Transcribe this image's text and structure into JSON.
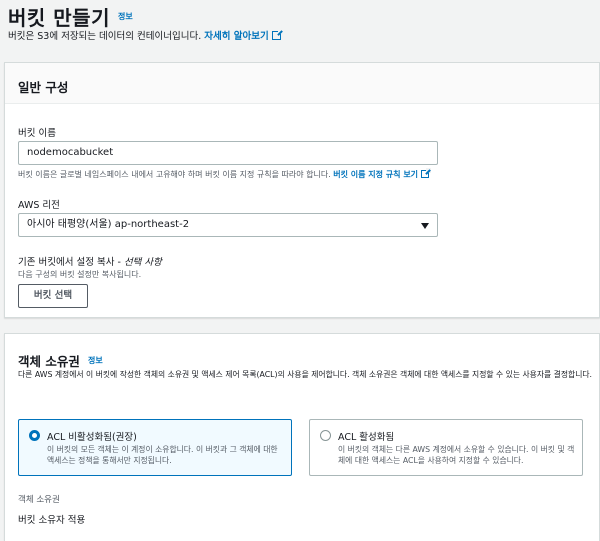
{
  "header": {
    "title": "버킷 만들기",
    "info": "정보",
    "description": "버킷은 S3에 저장되는 데이터의 컨테이너입니다.",
    "learn_more": "자세히 알아보기"
  },
  "general": {
    "title": "일반 구성",
    "bucket_name_label": "버킷 이름",
    "bucket_name_value": "nodemocabucket",
    "bucket_name_hint": "버킷 이름은 글로벌 네임스페이스 내에서 고유해야 하며 버킷 이름 지정 규칙을 따라야 합니다.",
    "naming_rules_link": "버킷 이름 지정 규칙 보기",
    "region_label": "AWS 리전",
    "region_value": "아시아 태평양(서울) ap-northeast-2",
    "copy_label": "기존 버킷에서 설정 복사 - ",
    "copy_optional": "선택 사항",
    "copy_hint": "다음 구성의 버킷 설정만 복사됩니다.",
    "choose_bucket_button": "버킷 선택"
  },
  "ownership": {
    "title": "객체 소유권",
    "info": "정보",
    "description": "다른 AWS 계정에서 이 버킷에 작성한 객체의 소유권 및 액세스 제어 목록(ACL)의 사용을 제어합니다. 객체 소유권은 객체에 대한 액세스를 지정할 수 있는 사용자를 결정합니다.",
    "options": [
      {
        "label": "ACL 비활성화됨(권장)",
        "description": "이 버킷의 모든 객체는 이 계정이 소유합니다. 이 버킷과 그 객체에 대한 액세스는 정책을 통해서만 지정됩니다.",
        "selected": true
      },
      {
        "label": "ACL 활성화됨",
        "description": "이 버킷의 객체는 다른 AWS 계정에서 소유할 수 있습니다. 이 버킷 및 객체에 대한 액세스는 ACL을 사용하여 지정할 수 있습니다.",
        "selected": false
      }
    ],
    "owner_label": "객체 소유권",
    "owner_value": "버킷 소유자 적용"
  },
  "colors": {
    "accent": "#0073bb",
    "text": "#16191f",
    "muted": "#545b64"
  }
}
